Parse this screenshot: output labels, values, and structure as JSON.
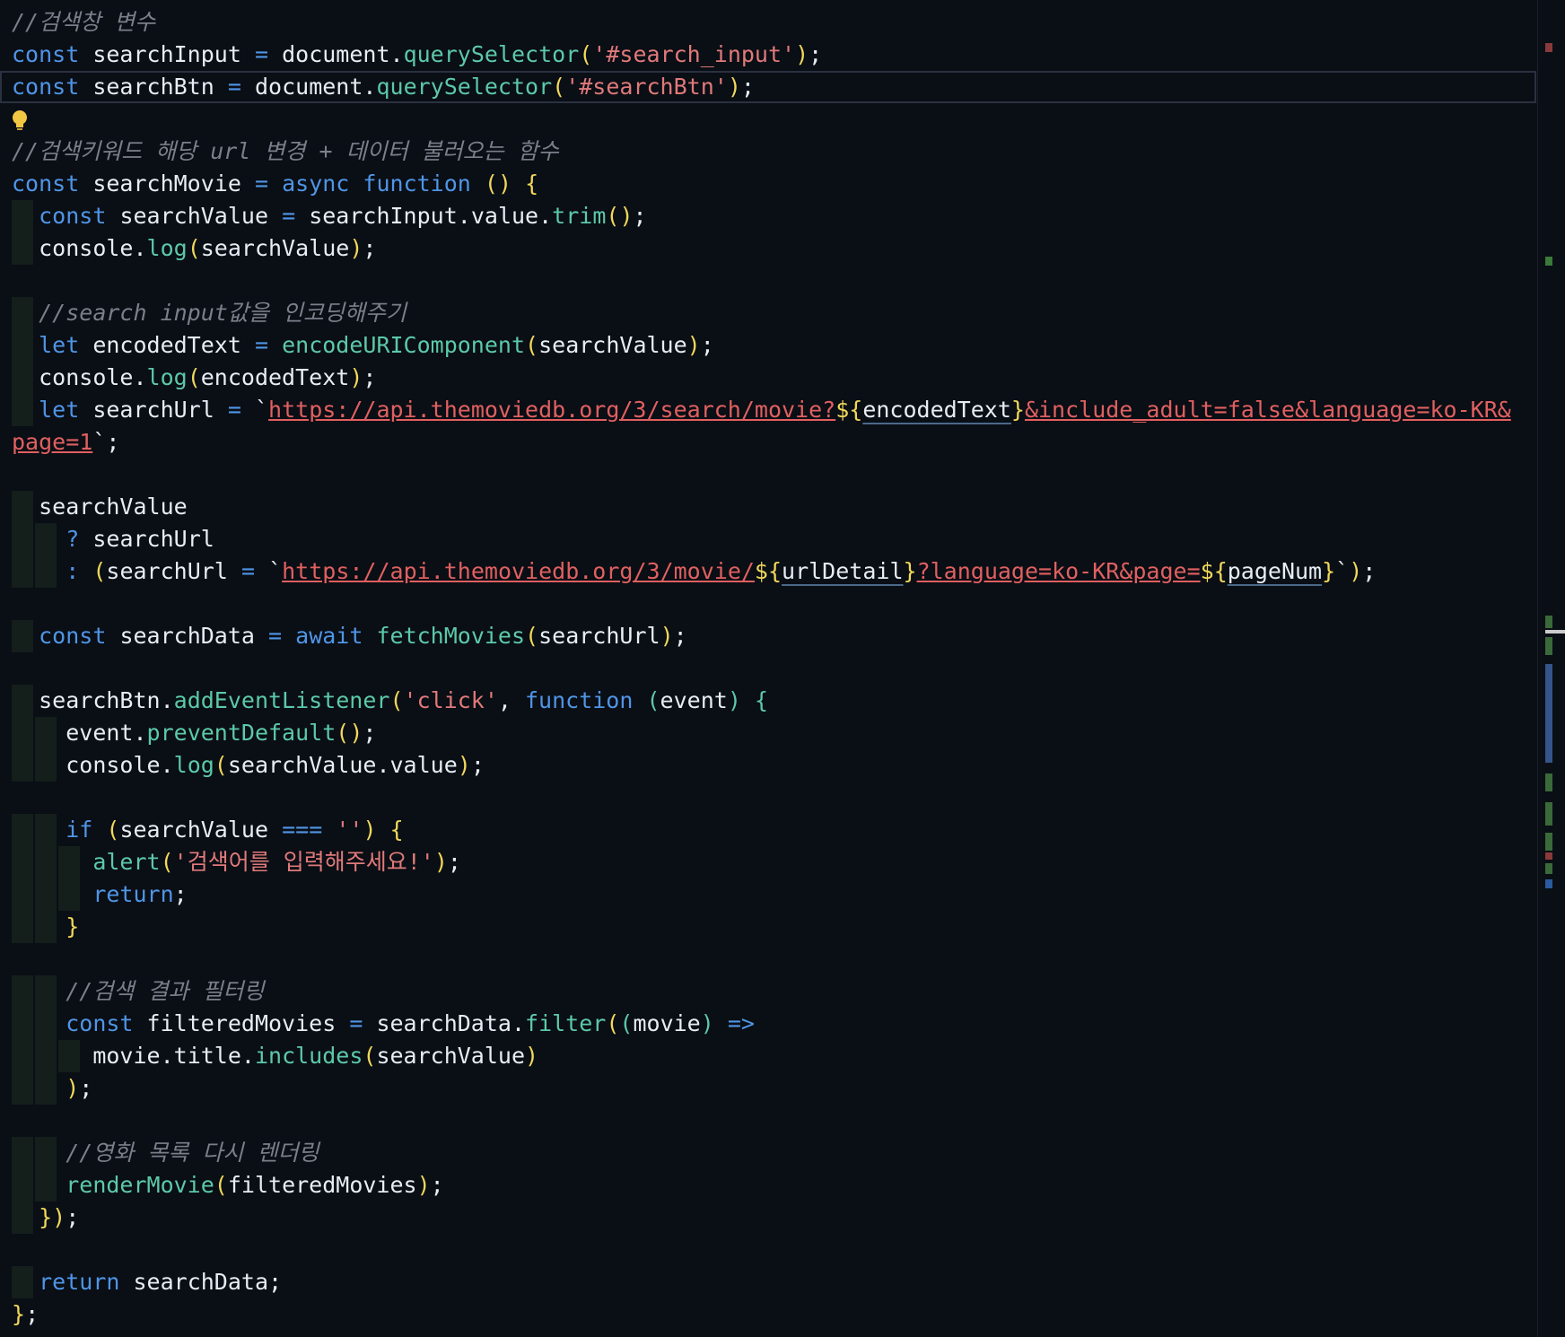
{
  "editor": {
    "language": "javascript",
    "lines": [
      "//검색창 변수",
      "const searchInput = document.querySelector('#search_input');",
      "const searchBtn = document.querySelector('#searchBtn');",
      "",
      "//검색키워드 해당 url 변경 + 데이터 불러오는 함수",
      "const searchMovie = async function () {",
      "  const searchValue = searchInput.value.trim();",
      "  console.log(searchValue);",
      "",
      "  //search input값을 인코딩해주기",
      "  let encodedText = encodeURIComponent(searchValue);",
      "  console.log(encodedText);",
      "  let searchUrl = `https://api.themoviedb.org/3/search/movie?${encodedText}&include_adult=false&language=ko-KR&",
      "page=1`;",
      "",
      "  searchValue",
      "    ? searchUrl",
      "    : (searchUrl = `https://api.themoviedb.org/3/movie/${urlDetail}?language=ko-KR&page=${pageNum}`);",
      "",
      "  const searchData = await fetchMovies(searchUrl);",
      "",
      "  searchBtn.addEventListener('click', function (event) {",
      "    event.preventDefault();",
      "    console.log(searchValue.value);",
      "",
      "    if (searchValue === '') {",
      "      alert('검색어를 입력해주세요!');",
      "      return;",
      "    }",
      "",
      "    //검색 결과 필터링",
      "    const filteredMovies = searchData.filter((movie) =>",
      "      movie.title.includes(searchValue)",
      "    );",
      "",
      "    //영화 목록 다시 렌더링",
      "    renderMovie(filteredMovies);",
      "  });",
      "",
      "  return searchData;",
      "};"
    ],
    "colors": {
      "background": "#0a0e15",
      "keyword": "#4f95e6",
      "function": "#5cc9a8",
      "string": "#e07a7a",
      "comment": "#7a808a",
      "bracket_yellow": "#f0d85a"
    },
    "icons": {
      "lightbulb": "lightbulb-icon"
    }
  }
}
